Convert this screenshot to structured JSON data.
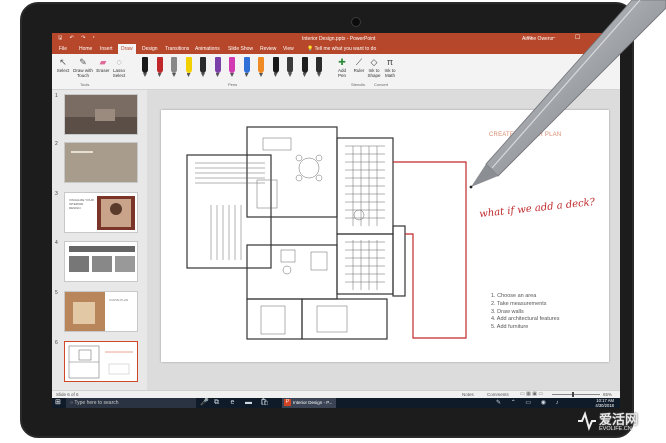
{
  "titlebar": {
    "doc_title": "Interior Design.pptx",
    "separator": "-",
    "app_name": "PowerPoint",
    "user": "Aimee Owens"
  },
  "ribbon_tabs": [
    "File",
    "Home",
    "Insert",
    "Draw",
    "Design",
    "Transitions",
    "Animations",
    "Slide Show",
    "Review",
    "View"
  ],
  "active_tab": "Draw",
  "tell_me": "Tell me what you want to do",
  "ribbon": {
    "tools_group": "Tools",
    "pens_group": "Pens",
    "stencils_group": "Stencils",
    "convert_group": "Convert",
    "select_label": "Select",
    "draw_touch_label": "Draw with Touch",
    "eraser_label": "Eraser",
    "lasso_label": "Lasso Select",
    "add_pen_label": "Add Pen",
    "ruler_label": "Ruler",
    "ink_shape_label": "Ink to Shape",
    "ink_math_label": "Ink to Math"
  },
  "pen_colors": [
    "#1a1a1a",
    "#c0282b",
    "#888888",
    "#f2d000",
    "#2a2a2a",
    "#7a3fa8",
    "#d23ab2",
    "#2f6fd8",
    "#f08a24",
    "#1a1a1a",
    "#3a3a3a",
    "#1f1f1f",
    "#2b2b2b"
  ],
  "slides": {
    "numbers": [
      "1",
      "2",
      "3",
      "4",
      "5",
      "6"
    ],
    "thumb3_text": "VISUALIZE YOUR INTERIOR DESIGN",
    "thumb5_text": "CURVE PLAN"
  },
  "slide": {
    "title": "CREATE A FLOOR PLAN",
    "handwriting": "what if we add a deck?",
    "list": [
      "1. Choose an area",
      "2. Take measurements",
      "3. Draw walls",
      "4. Add architectural features",
      "5. Add furniture"
    ]
  },
  "statusbar": {
    "slide_count": "Slide 6 of 6",
    "notes": "Notes",
    "comments": "Comments",
    "zoom": "65%"
  },
  "taskbar": {
    "search_placeholder": "Type here to search",
    "app_label": "Interior Design - P...",
    "time": "10:17 AM",
    "date": "4/30/2018"
  },
  "watermark": {
    "name": "爱活网",
    "domain": "EVOLIFE.CN"
  }
}
